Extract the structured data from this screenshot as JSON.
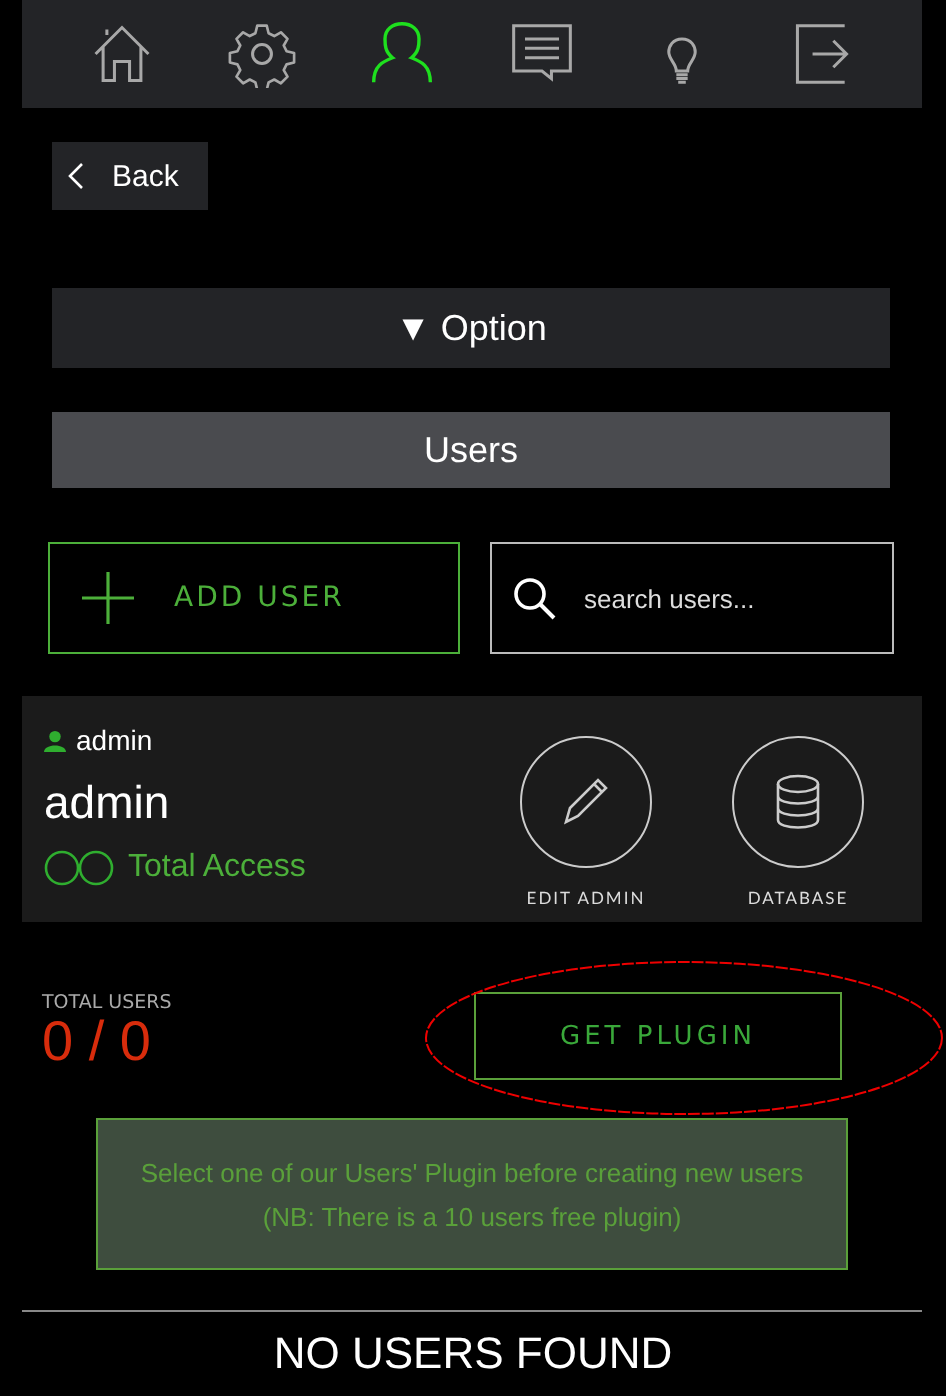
{
  "nav": {
    "items": [
      {
        "kind": "home",
        "selected": false
      },
      {
        "kind": "settings",
        "selected": false
      },
      {
        "kind": "user",
        "selected": true
      },
      {
        "kind": "messages",
        "selected": false
      },
      {
        "kind": "idea",
        "selected": false
      },
      {
        "kind": "logout",
        "selected": false
      }
    ]
  },
  "back": {
    "label": "Back"
  },
  "option": {
    "marker": "▼",
    "label": "Option"
  },
  "section_title": "Users",
  "add_user": {
    "label": "ADD USER"
  },
  "search": {
    "placeholder": "search users..."
  },
  "user_card": {
    "username": "admin",
    "name": "admin",
    "access": "Total Access",
    "actions": [
      {
        "kind": "edit",
        "label": "EDIT ADMIN"
      },
      {
        "kind": "database",
        "label": "DATABASE"
      }
    ]
  },
  "total_users": {
    "label": "TOTAL USERS",
    "value": "0 / 0"
  },
  "get_plugin": {
    "label": "GET PLUGIN",
    "highlighted": true
  },
  "notice": {
    "lines": [
      "Select one of our Users' Plugin before creating new users",
      "(NB: There is a 10 users free plugin)"
    ]
  },
  "empty_message": "NO USERS FOUND"
}
